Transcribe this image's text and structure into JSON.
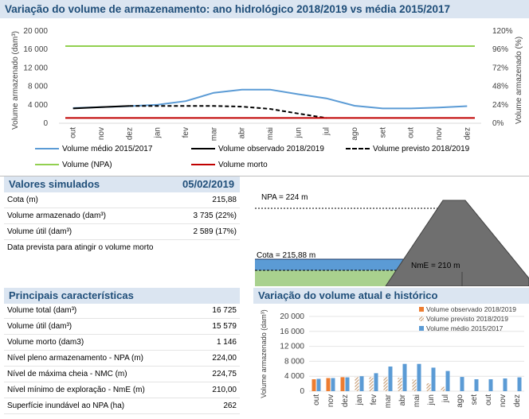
{
  "top_chart": {
    "title": "Variação do volume de armazenamento: ano hidrológico 2018/2019 vs média 2015/2017",
    "ylabel_left": "Volume armazenado (dam³)",
    "ylabel_right": "Volume armazenado (%)",
    "legend": [
      {
        "label": "Volume médio 2015/2017",
        "color": "#5b9bd5",
        "style": "solid"
      },
      {
        "label": "Volume observado 2018/2019",
        "color": "#000000",
        "style": "solid"
      },
      {
        "label": "Volume previsto 2018/2019",
        "color": "#000000",
        "style": "dashed"
      },
      {
        "label": "Volume (NPA)",
        "color": "#92d050",
        "style": "solid"
      },
      {
        "label": "Volume morto",
        "color": "#c00000",
        "style": "solid"
      }
    ]
  },
  "chart_data": [
    {
      "type": "line",
      "x": [
        "out",
        "nov",
        "dez",
        "jan",
        "fev",
        "mar",
        "abr",
        "mai",
        "jun",
        "jul",
        "ago",
        "set",
        "out",
        "nov",
        "dez"
      ],
      "ylim": [
        0,
        20000
      ],
      "yticks": [
        "0",
        "4 000",
        "8 000",
        "12 000",
        "16 000",
        "20 000"
      ],
      "y2ticks": [
        "0%",
        "24%",
        "48%",
        "72%",
        "96%",
        "120%"
      ],
      "ylim2": [
        0,
        1.2
      ],
      "series": [
        {
          "name": "Volume médio 2015/2017",
          "values": [
            3300,
            3500,
            3700,
            4000,
            4800,
            6600,
            7300,
            7300,
            6300,
            5400,
            3800,
            3200,
            3200,
            3400,
            3700
          ]
        },
        {
          "name": "Volume observado 2018/2019",
          "values": [
            3200,
            3500,
            3735,
            null,
            null,
            null,
            null,
            null,
            null,
            null,
            null,
            null,
            null,
            null,
            null
          ]
        },
        {
          "name": "Volume previsto 2018/2019",
          "values": [
            null,
            null,
            3735,
            3735,
            3735,
            3735,
            3600,
            3100,
            2100,
            1146,
            null,
            null,
            null,
            null,
            null
          ]
        },
        {
          "name": "Volume (NPA)",
          "values": [
            16725,
            16725,
            16725,
            16725,
            16725,
            16725,
            16725,
            16725,
            16725,
            16725,
            16725,
            16725,
            16725,
            16725,
            16725
          ]
        },
        {
          "name": "Volume morto",
          "values": [
            1146,
            1146,
            1146,
            1146,
            1146,
            1146,
            1146,
            1146,
            1146,
            1146,
            1146,
            1146,
            1146,
            1146,
            1146
          ]
        }
      ]
    },
    {
      "type": "bar",
      "title": "Variação do volume atual e histórico",
      "ylabel": "Volume armazenado (dam³)",
      "categories": [
        "out",
        "nov",
        "dez",
        "jan",
        "fev",
        "mar",
        "abr",
        "mai",
        "jun",
        "jul",
        "ago",
        "set",
        "out",
        "nov",
        "dez"
      ],
      "ylim": [
        0,
        20000
      ],
      "yticks": [
        "0",
        "4 000",
        "8 000",
        "12 000",
        "16 000",
        "20 000"
      ],
      "legend_position": "top-right",
      "series": [
        {
          "name": "Volume observado 2018/2019",
          "color": "#ed7d31",
          "pattern": "solid",
          "values": [
            3200,
            3500,
            3735,
            0,
            0,
            0,
            0,
            0,
            0,
            0,
            0,
            0,
            0,
            0,
            0
          ]
        },
        {
          "name": "Volume previsto 2018/2019",
          "color": "#c9a27c",
          "pattern": "hatched",
          "values": [
            0,
            0,
            0,
            3735,
            3735,
            3735,
            3600,
            3100,
            2100,
            1146,
            0,
            0,
            0,
            0,
            0
          ]
        },
        {
          "name": "Volume médio 2015/2017",
          "color": "#5b9bd5",
          "pattern": "solid",
          "values": [
            3300,
            3500,
            3700,
            4000,
            4800,
            6600,
            7300,
            7300,
            6300,
            5400,
            3800,
            3200,
            3200,
            3400,
            3700
          ]
        }
      ]
    }
  ],
  "simulated": {
    "title": "Valores simulados",
    "date": "05/02/2019",
    "rows": [
      {
        "label": "Cota (m)",
        "value": "215,88"
      },
      {
        "label": "Volume armazenado (dam³)",
        "value": "3 735 (22%)"
      },
      {
        "label": "Volume útil (dam³)",
        "value": "2 589 (17%)"
      },
      {
        "label": "Data prevista para atingir o volume morto",
        "value": ""
      }
    ]
  },
  "dam": {
    "npa_label": "NPA = 224 m",
    "cota_label": "Cota = 215,88 m",
    "nme_label": "NmE = 210 m"
  },
  "characteristics": {
    "title": "Principais características",
    "rows": [
      {
        "label": "Volume total (dam³)",
        "value": "16 725"
      },
      {
        "label": "Volume útil (dam³)",
        "value": "15 579"
      },
      {
        "label": "Volume morto (dam3)",
        "value": "1 146"
      },
      {
        "label": "Nível pleno armazenamento - NPA (m)",
        "value": "224,00"
      },
      {
        "label": "Nível de máxima cheia - NMC (m)",
        "value": "224,75"
      },
      {
        "label": "Nível mínimo de exploração - NmE (m)",
        "value": "210,00"
      },
      {
        "label": "Superfície inundável ao NPA (ha)",
        "value": "262"
      }
    ]
  }
}
